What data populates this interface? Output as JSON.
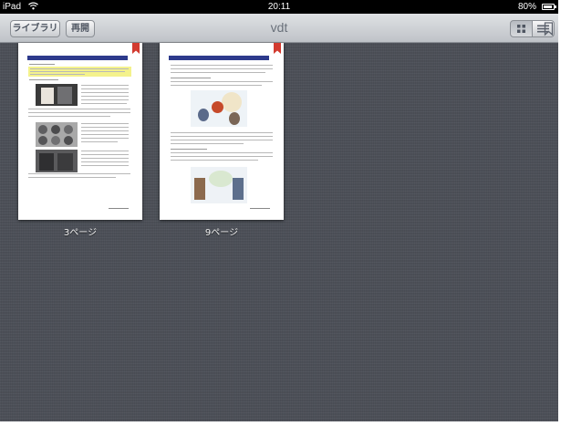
{
  "status_bar": {
    "device": "iPad",
    "wifi_icon": "wifi-icon",
    "time": "20:11",
    "battery_text": "80%",
    "battery_level": 0.8
  },
  "toolbar": {
    "library_label": "ライブラリ",
    "resume_label": "再開",
    "title": "vdt",
    "view_grid_icon": "grid-icon",
    "view_list_icon": "list-icon",
    "bookmark_icon": "bookmark-icon"
  },
  "pages": [
    {
      "label": "3ページ",
      "bookmarked": true
    },
    {
      "label": "9ページ",
      "bookmarked": true
    }
  ],
  "colors": {
    "background": "#4c5058",
    "toolbar": "#cfd2d6",
    "page_header": "#2d3a8c",
    "ribbon": "#d23a2f",
    "highlight": "#f4f28c"
  }
}
